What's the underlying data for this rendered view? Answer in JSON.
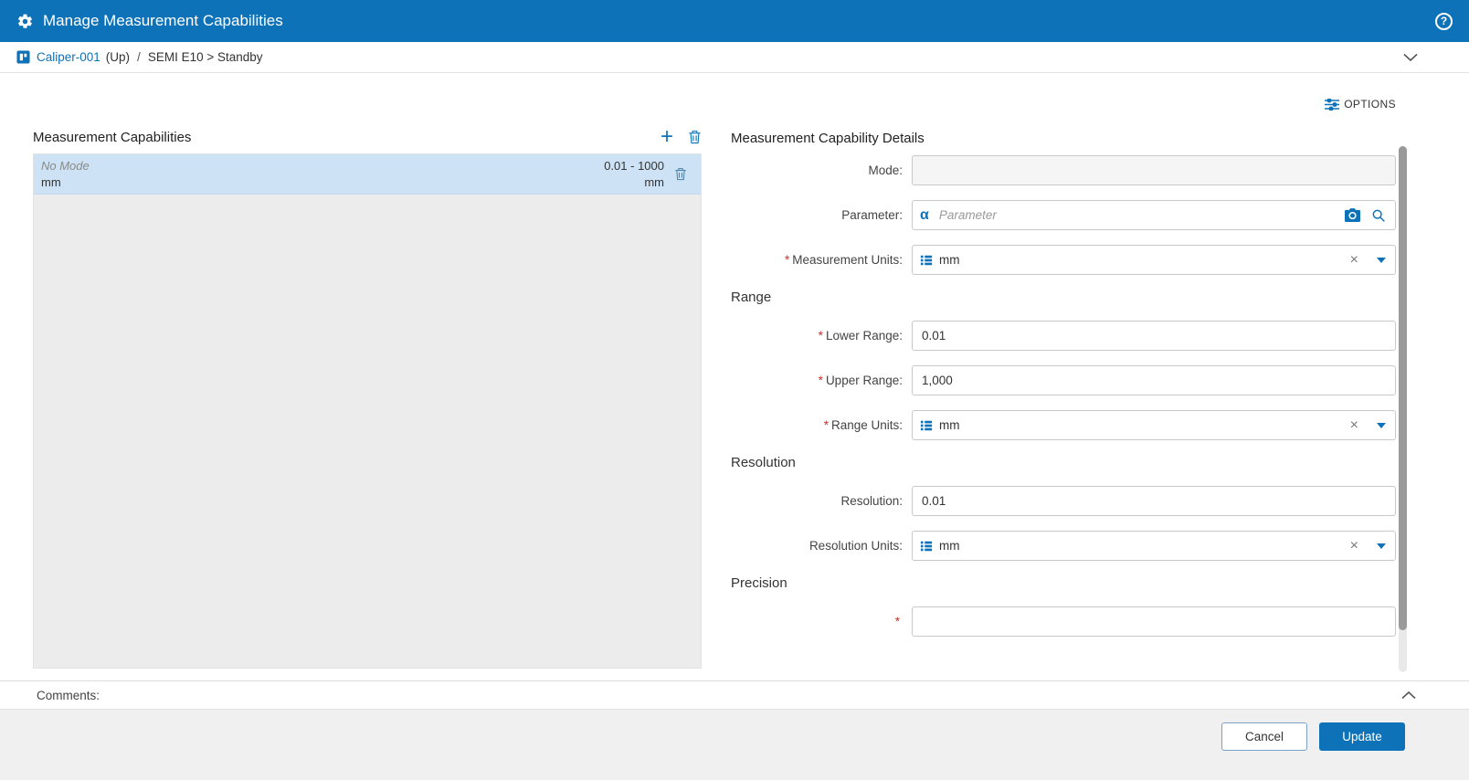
{
  "colors": {
    "header_bg": "#0e72b8",
    "accent": "#0e72b8",
    "selected_row": "#cde2f4",
    "required_marker_color": "#c9302c"
  },
  "icons": {
    "gear": "gear",
    "help": "?",
    "equipment": "equipment-badge",
    "chevron_down": "chevron-down",
    "chevron_up": "chevron-up",
    "options": "sliders",
    "add": "+",
    "delete": "trash",
    "alpha": "α",
    "camera": "camera",
    "search": "magnifier",
    "unit_list": "list",
    "clear": "×",
    "dropdown": "caret-down"
  },
  "header": {
    "title": "Manage Measurement Capabilities"
  },
  "breadcrumb": {
    "device": "Caliper-001",
    "up_label": "(Up)",
    "separator": "/",
    "path": "SEMI E10 > Standby"
  },
  "toolbar": {
    "options_label": "OPTIONS"
  },
  "list_panel": {
    "title": "Measurement Capabilities",
    "items": [
      {
        "mode": "No Mode",
        "range": "0.01 - 1000",
        "measurement_units": "mm",
        "range_units": "mm"
      }
    ]
  },
  "details": {
    "title": "Measurement Capability Details",
    "required_marker": "*",
    "mode": {
      "label": "Mode:",
      "value": ""
    },
    "parameter": {
      "label": "Parameter:",
      "placeholder": "Parameter",
      "value": ""
    },
    "measurement_units": {
      "label": "Measurement Units:",
      "value": "mm"
    },
    "sections": {
      "range": "Range",
      "resolution": "Resolution",
      "precision": "Precision"
    },
    "lower_range": {
      "label": "Lower Range:",
      "value": "0.01"
    },
    "upper_range": {
      "label": "Upper Range:",
      "value": "1,000"
    },
    "range_units": {
      "label": "Range Units:",
      "value": "mm"
    },
    "resolution": {
      "label": "Resolution:",
      "value": "0.01"
    },
    "resolution_units": {
      "label": "Resolution Units:",
      "value": "mm"
    }
  },
  "comments": {
    "label": "Comments:"
  },
  "footer": {
    "cancel_label": "Cancel",
    "update_label": "Update"
  }
}
